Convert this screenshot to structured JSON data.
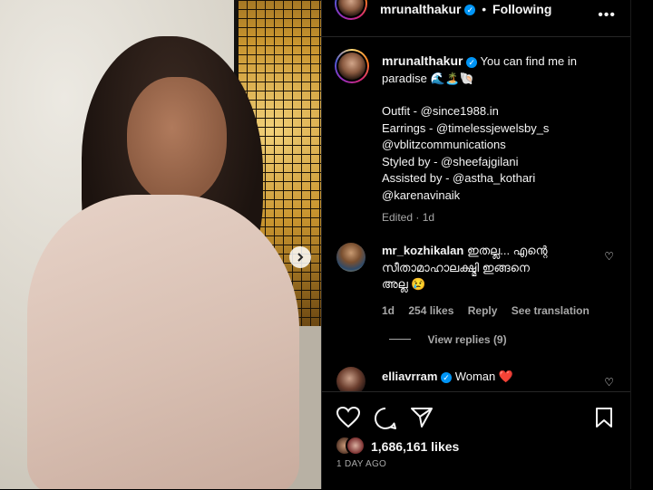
{
  "post": {
    "username": "mrunalthakur",
    "follow_sep": "•",
    "follow_state": "Following",
    "more_icon": "more-horizontal-icon"
  },
  "caption": {
    "username": "mrunalthakur",
    "text_line1": "You can find me in",
    "text_line2": "paradise 🌊🏝️🐚",
    "lines": [
      "Outfit - @since1988.in",
      "Earrings - @timelessjewelsby_s",
      "@vblitzcommunications",
      "Styled by - @sheefajgilani",
      "Assisted by - @astha_kothari",
      "@karenavinaik"
    ],
    "edited": "Edited · 1d"
  },
  "comments": [
    {
      "username": "mr_kozhikalan",
      "text_line1": "ഇതല്ല... എന്റെ",
      "text_line2": "സീതാമാഹാലക്ഷ്മി ഇങ്ങനെ",
      "text_line3": "അല്ല 😢",
      "time": "1d",
      "likes": "254 likes",
      "reply": "Reply",
      "translate": "See translation",
      "view_replies": "View replies (9)"
    },
    {
      "username": "elliavrram",
      "text": "Woman ❤️"
    }
  ],
  "actions": {
    "likes": "1,686,161 likes",
    "time_ago": "1 DAY AGO"
  },
  "colors": {
    "verified": "#0095f6",
    "muted": "#a8a8a8",
    "background": "#000000"
  }
}
